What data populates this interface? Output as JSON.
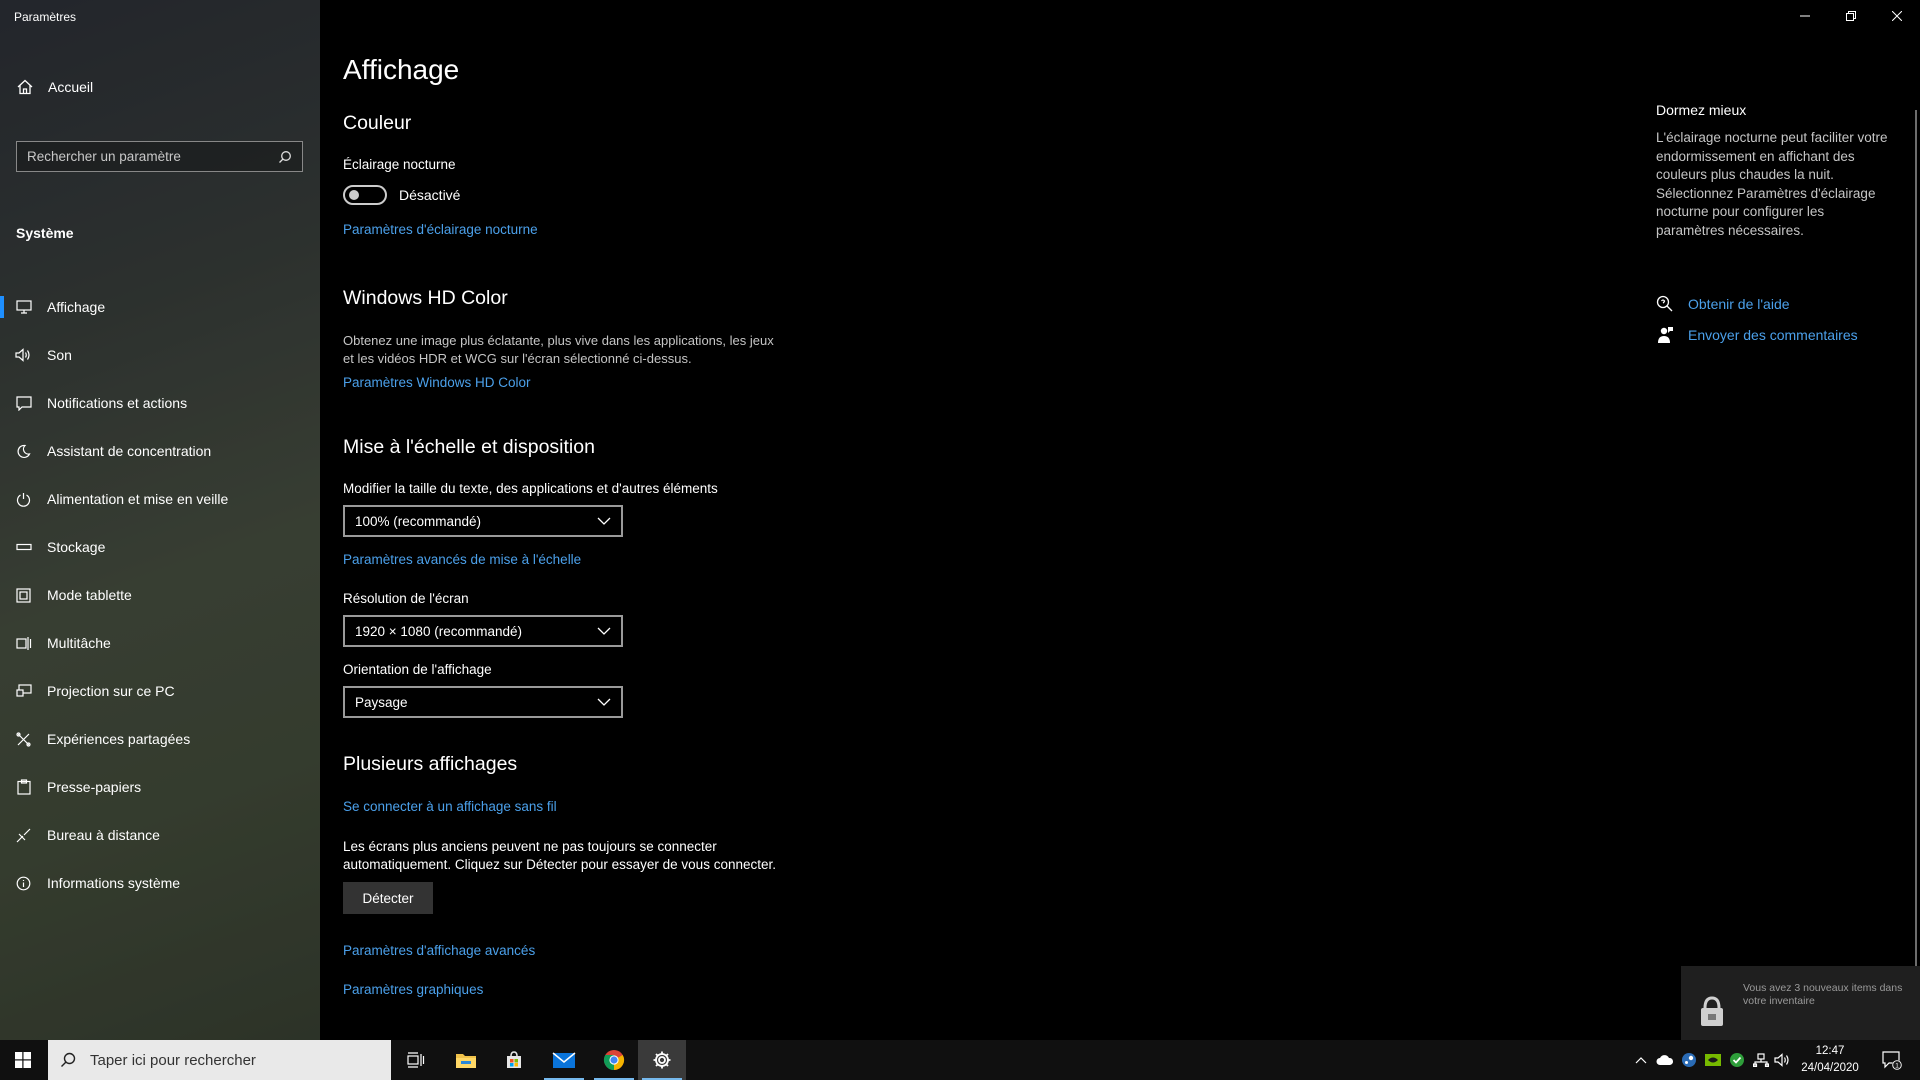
{
  "window": {
    "title": "Paramètres"
  },
  "sidebar": {
    "home_label": "Accueil",
    "search_placeholder": "Rechercher un paramètre",
    "section": "Système",
    "items": [
      {
        "label": "Affichage",
        "icon": "monitor-icon",
        "active": true
      },
      {
        "label": "Son",
        "icon": "speaker-icon"
      },
      {
        "label": "Notifications et actions",
        "icon": "notification-icon"
      },
      {
        "label": "Assistant de concentration",
        "icon": "moon-icon"
      },
      {
        "label": "Alimentation et mise en veille",
        "icon": "power-icon"
      },
      {
        "label": "Stockage",
        "icon": "storage-icon"
      },
      {
        "label": "Mode tablette",
        "icon": "tablet-icon"
      },
      {
        "label": "Multitâche",
        "icon": "multitask-icon"
      },
      {
        "label": "Projection sur ce PC",
        "icon": "projection-icon"
      },
      {
        "label": "Expériences partagées",
        "icon": "shared-icon"
      },
      {
        "label": "Presse-papiers",
        "icon": "clipboard-icon"
      },
      {
        "label": "Bureau à distance",
        "icon": "remote-icon"
      },
      {
        "label": "Informations système",
        "icon": "info-icon"
      }
    ]
  },
  "main": {
    "title": "Affichage",
    "color": {
      "heading": "Couleur",
      "night_light_label": "Éclairage nocturne",
      "toggle_state": "Désactivé",
      "toggle_on": false,
      "night_light_link": "Paramètres d'éclairage nocturne"
    },
    "hdr": {
      "heading": "Windows HD Color",
      "description": "Obtenez une image plus éclatante, plus vive dans les applications, les jeux et les vidéos HDR et WCG sur l'écran sélectionné ci-dessus.",
      "link": "Paramètres Windows HD Color"
    },
    "scale": {
      "heading": "Mise à l'échelle et disposition",
      "size_label": "Modifier la taille du texte, des applications et d'autres éléments",
      "size_value": "100% (recommandé)",
      "advanced_link": "Paramètres avancés de mise à l'échelle",
      "resolution_label": "Résolution de l'écran",
      "resolution_value": "1920 × 1080 (recommandé)",
      "orientation_label": "Orientation de l'affichage",
      "orientation_value": "Paysage"
    },
    "multi": {
      "heading": "Plusieurs affichages",
      "wireless_link": "Se connecter à un affichage sans fil",
      "description": "Les écrans plus anciens peuvent ne pas toujours se connecter automatiquement. Cliquez sur Détecter pour essayer de vous connecter.",
      "detect_button": "Détecter",
      "advanced_display_link": "Paramètres d'affichage avancés",
      "graphics_link": "Paramètres graphiques"
    }
  },
  "right_pane": {
    "title": "Dormez mieux",
    "description": "L'éclairage nocturne peut faciliter votre endormissement en affichant des couleurs plus chaudes la nuit. Sélectionnez Paramètres d'éclairage nocturne pour configurer les paramètres nécessaires.",
    "help_link": "Obtenir de l'aide",
    "feedback_link": "Envoyer des commentaires"
  },
  "toast": {
    "message": "Vous avez 3 nouveaux items dans votre inventaire"
  },
  "taskbar": {
    "search_placeholder": "Taper ici pour rechercher",
    "time": "12:47",
    "date": "24/04/2020",
    "notification_count": "1",
    "apps": [
      "task-view-icon",
      "file-explorer-icon",
      "store-icon",
      "mail-icon",
      "chrome-icon",
      "settings-icon"
    ]
  },
  "colors": {
    "accent": "#1e8fff",
    "link": "#4ba0ea",
    "background": "#000000"
  }
}
